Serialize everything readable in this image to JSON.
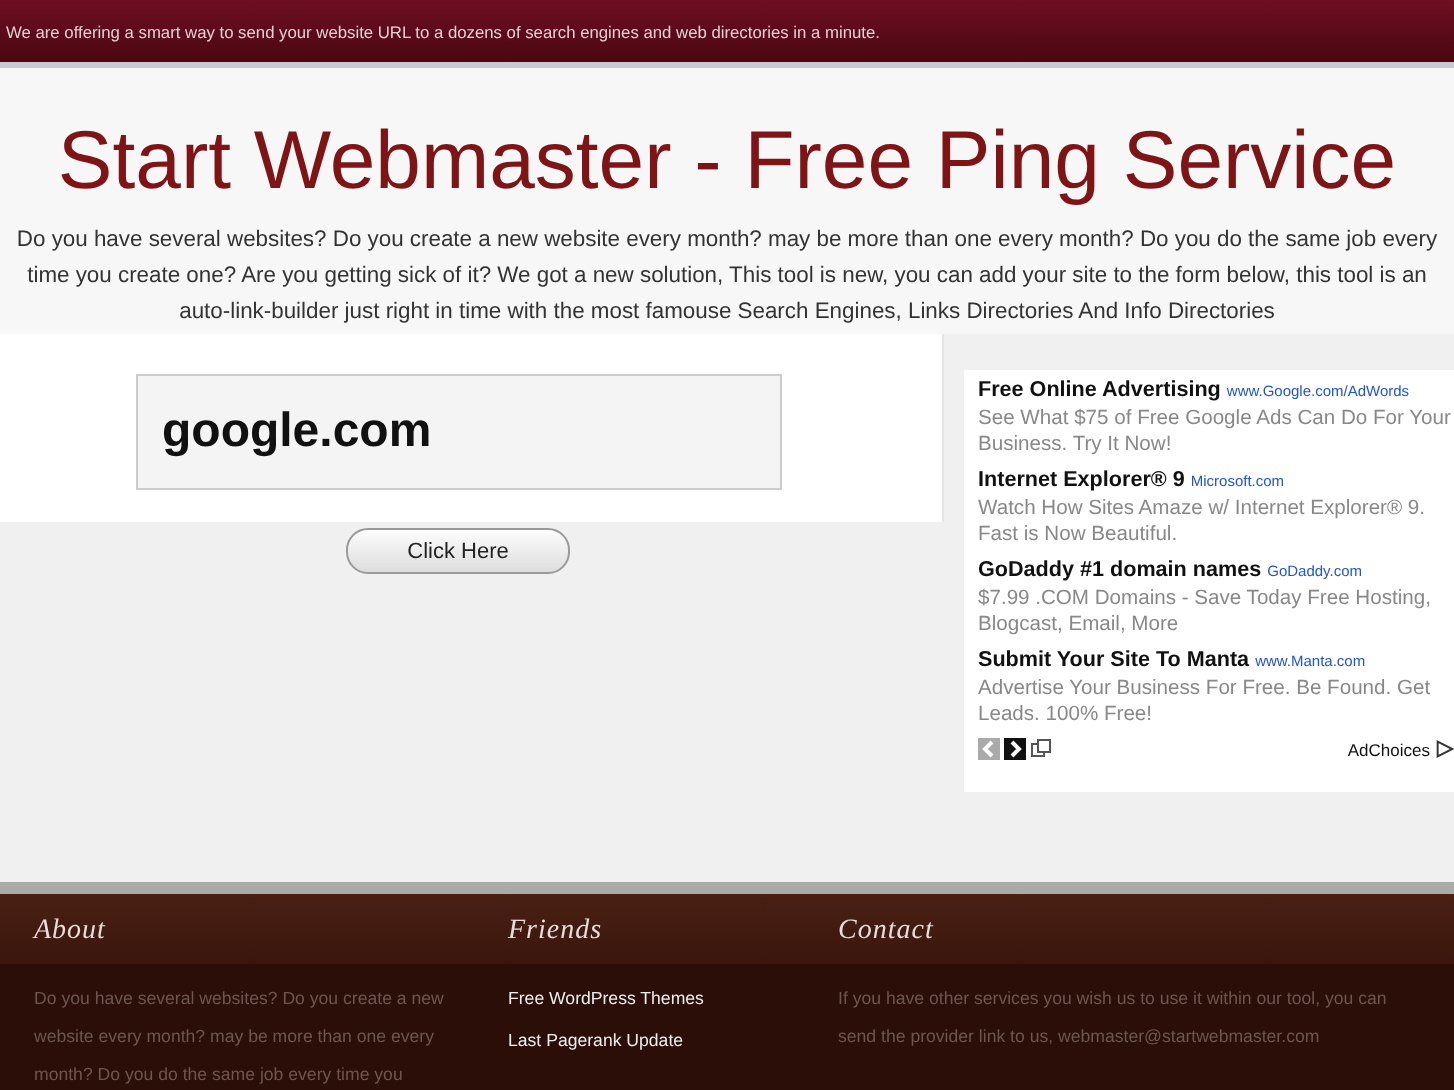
{
  "top_bar": {
    "text": "We are offering a smart way to send your website URL to a dozens of search engines and web directories in a minute."
  },
  "header": {
    "title": "Start Webmaster - Free Ping Service",
    "description": "Do you have several websites? Do you create a new website every month? may be more than one every month? Do you do the same job every time you create one? Are you getting sick of it? We got a new solution, This tool is new, you can add your site to the form below, this tool is an auto-link-builder just right in time with the most famouse Search Engines, Links Directories And Info Directories"
  },
  "form": {
    "url_field": {
      "value": "google.com"
    },
    "button": "Click Here"
  },
  "ads": {
    "items": [
      {
        "title": "Free Online Advertising",
        "url": "www.Google.com/AdWords",
        "text": "See What $75 of Free Google Ads Can Do For Your Business. Try It Now!"
      },
      {
        "title": "Internet Explorer® 9",
        "url": "Microsoft.com",
        "text": "Watch How Sites Amaze w/ Internet Explorer® 9. Fast is Now Beautiful."
      },
      {
        "title": "GoDaddy #1 domain names",
        "url": "GoDaddy.com",
        "text": "$7.99 .COM Domains - Save Today Free Hosting, Blogcast, Email, More"
      },
      {
        "title": "Submit Your Site To Manta",
        "url": "www.Manta.com",
        "text": "Advertise Your Business For Free. Be Found. Get Leads. 100% Free!"
      }
    ],
    "adchoices": "AdChoices"
  },
  "footer": {
    "columns": [
      {
        "heading": "About",
        "kind": "text",
        "text": "Do you have several websites? Do you create a new website every month? may be more than one every month? Do you do the same job every time you"
      },
      {
        "heading": "Friends",
        "kind": "links",
        "links": [
          "Free WordPress Themes",
          "Last Pagerank Update"
        ]
      },
      {
        "heading": "Contact",
        "kind": "text",
        "text": "If you have other services you wish us to use it within our tool, you can send the provider link to us, webmaster@startwebmaster.com"
      }
    ]
  }
}
